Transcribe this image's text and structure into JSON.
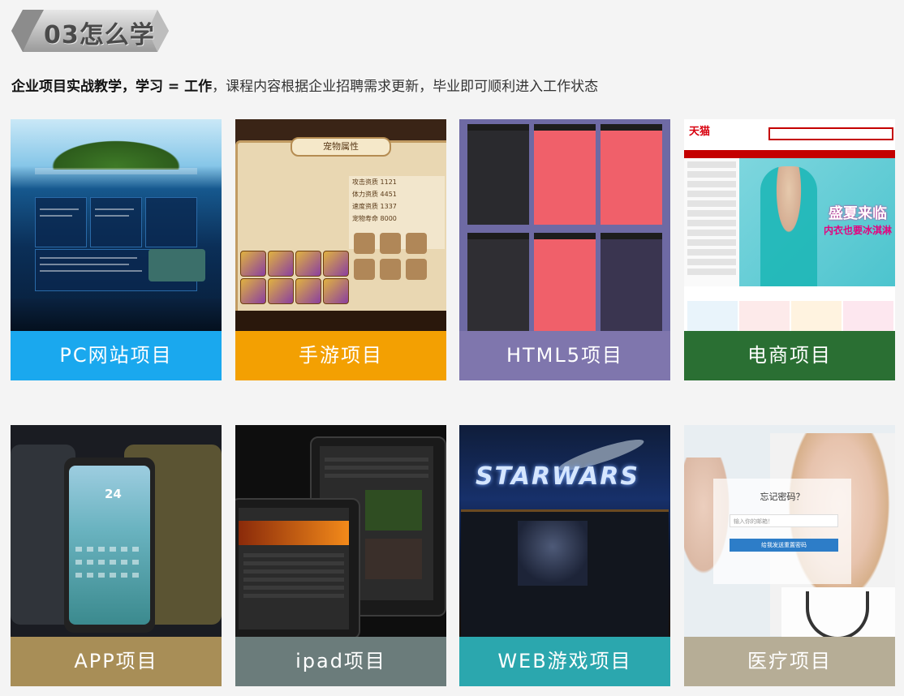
{
  "header": {
    "badge_text": "03怎么学",
    "intro_bold": "企业项目实战教学，学习 = 工作",
    "intro_rest": "，课程内容根据企业招聘需求更新，毕业即可顺利进入工作状态"
  },
  "cards": [
    {
      "label": "PC网站项目",
      "color": "#1aa8ee",
      "thumb": "website-screenshot"
    },
    {
      "label": "手游项目",
      "color": "#f3a002",
      "thumb": "mobile-game-screenshot"
    },
    {
      "label": "HTML5项目",
      "color": "#7f76ad",
      "thumb": "html5-screens"
    },
    {
      "label": "电商项目",
      "color": "#2a6f33",
      "thumb": "ecommerce-screenshot"
    },
    {
      "label": "APP项目",
      "color": "#a88e57",
      "thumb": "app-screens"
    },
    {
      "label": "ipad项目",
      "color": "#6b7c7b",
      "thumb": "ipad-screens"
    },
    {
      "label": "WEB游戏项目",
      "color": "#2ba7ae",
      "thumb": "web-game-screenshot"
    },
    {
      "label": "医疗项目",
      "color": "#b6ad96",
      "thumb": "medical-screenshot"
    }
  ],
  "thumb_text": {
    "game_title": "宠物属性",
    "game_stats": [
      "攻击资质 1121",
      "体力资质 4451",
      "速度资质 1337",
      "宠物寿命 8000"
    ],
    "shop_logo": "天猫",
    "shop_banner_1": "盛夏来临",
    "shop_banner_2": "内衣也要冰淇淋",
    "app_day": "24",
    "web_logo": "STARWARS",
    "med_title": "忘记密码？",
    "med_input": "输入你的邮箱！",
    "med_button": "给我发送重置密码"
  }
}
